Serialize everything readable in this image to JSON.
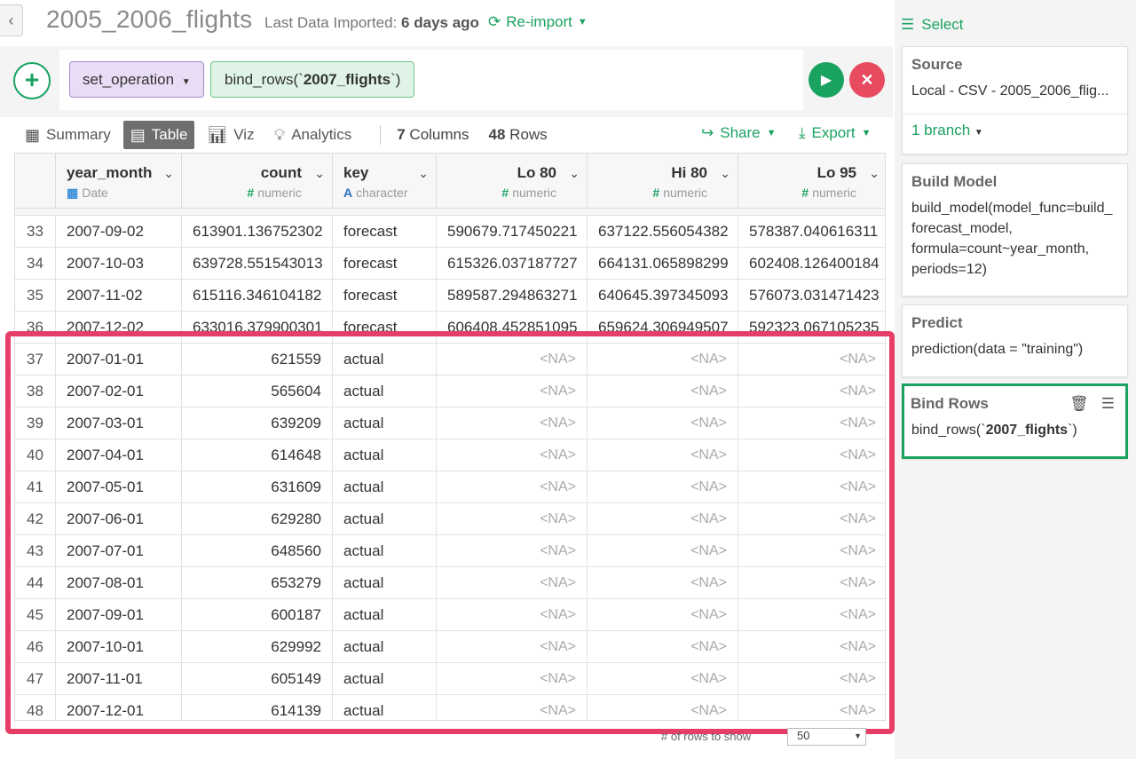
{
  "header": {
    "title": "2005_2006_flights",
    "imported_label": "Last Data Imported:",
    "imported_value": "6 days ago",
    "reimport_label": "Re-import"
  },
  "command": {
    "operation": "set_operation",
    "argument_prefix": "bind_rows(`",
    "argument_bold": "2007_flights",
    "argument_suffix": "`)"
  },
  "tabs": [
    {
      "label": "Summary",
      "icon": "summary-icon"
    },
    {
      "label": "Table",
      "icon": "table-icon",
      "active": true
    },
    {
      "label": "Viz",
      "icon": "chart-icon"
    },
    {
      "label": "Analytics",
      "icon": "lightbulb-icon"
    }
  ],
  "stats": {
    "columns_value": "7",
    "columns_label": "Columns",
    "rows_value": "48",
    "rows_label": "Rows"
  },
  "actions": {
    "share": "Share",
    "export": "Export"
  },
  "table": {
    "columns": [
      {
        "name": "year_month",
        "type": "Date",
        "type_icon": "calendar-icon"
      },
      {
        "name": "count",
        "type": "numeric",
        "type_icon": "#"
      },
      {
        "name": "key",
        "type": "character",
        "type_icon": "A"
      },
      {
        "name": "Lo 80",
        "type": "numeric",
        "type_icon": "#"
      },
      {
        "name": "Hi 80",
        "type": "numeric",
        "type_icon": "#"
      },
      {
        "name": "Lo 95",
        "type": "numeric",
        "type_icon": "#"
      }
    ],
    "rows": [
      [
        "33",
        "2007-09-02",
        "613901.136752302",
        "forecast",
        "590679.717450221",
        "637122.556054382",
        "578387.040616311"
      ],
      [
        "34",
        "2007-10-03",
        "639728.551543013",
        "forecast",
        "615326.037187727",
        "664131.065898299",
        "602408.126400184"
      ],
      [
        "35",
        "2007-11-02",
        "615116.346104182",
        "forecast",
        "589587.294863271",
        "640645.397345093",
        "576073.031471423"
      ],
      [
        "36",
        "2007-12-02",
        "633016.379900301",
        "forecast",
        "606408.452851095",
        "659624.306949507",
        "592323.067105235"
      ],
      [
        "37",
        "2007-01-01",
        "621559",
        "actual",
        "<NA>",
        "<NA>",
        "<NA>"
      ],
      [
        "38",
        "2007-02-01",
        "565604",
        "actual",
        "<NA>",
        "<NA>",
        "<NA>"
      ],
      [
        "39",
        "2007-03-01",
        "639209",
        "actual",
        "<NA>",
        "<NA>",
        "<NA>"
      ],
      [
        "40",
        "2007-04-01",
        "614648",
        "actual",
        "<NA>",
        "<NA>",
        "<NA>"
      ],
      [
        "41",
        "2007-05-01",
        "631609",
        "actual",
        "<NA>",
        "<NA>",
        "<NA>"
      ],
      [
        "42",
        "2007-06-01",
        "629280",
        "actual",
        "<NA>",
        "<NA>",
        "<NA>"
      ],
      [
        "43",
        "2007-07-01",
        "648560",
        "actual",
        "<NA>",
        "<NA>",
        "<NA>"
      ],
      [
        "44",
        "2007-08-01",
        "653279",
        "actual",
        "<NA>",
        "<NA>",
        "<NA>"
      ],
      [
        "45",
        "2007-09-01",
        "600187",
        "actual",
        "<NA>",
        "<NA>",
        "<NA>"
      ],
      [
        "46",
        "2007-10-01",
        "629992",
        "actual",
        "<NA>",
        "<NA>",
        "<NA>"
      ],
      [
        "47",
        "2007-11-01",
        "605149",
        "actual",
        "<NA>",
        "<NA>",
        "<NA>"
      ],
      [
        "48",
        "2007-12-01",
        "614139",
        "actual",
        "<NA>",
        "<NA>",
        "<NA>"
      ]
    ]
  },
  "footer": {
    "rows_to_show_label": "# of rows to show",
    "rows_to_show_value": "50"
  },
  "right_panel": {
    "select_label": "Select",
    "source_title": "Source",
    "source_body": "Local - CSV - 2005_2006_flig...",
    "branch_label": "1 branch",
    "build_model_title": "Build Model",
    "build_model_body": "build_model(model_func=build_ forecast_model, formula=count~year_month, periods=12)",
    "predict_title": "Predict",
    "predict_body": "prediction(data = \"training\")",
    "bind_rows_title": "Bind Rows",
    "bind_rows_prefix": "bind_rows(`",
    "bind_rows_bold": "2007_flights",
    "bind_rows_suffix": "`)"
  },
  "colors": {
    "accent": "#1aa260",
    "cancel": "#e84a5f",
    "highlight": "#e63e66",
    "op_chip": "#e9dcf5",
    "arg_chip": "#dff4e6"
  }
}
